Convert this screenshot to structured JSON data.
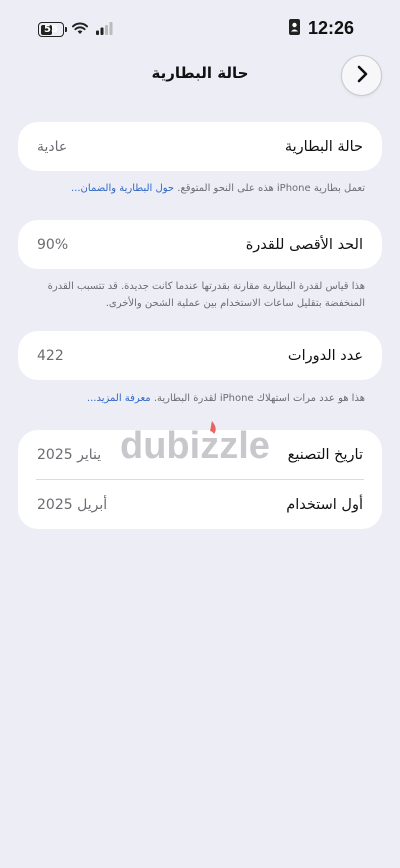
{
  "status_bar": {
    "time": "12:26",
    "battery_level": "55",
    "icons": [
      "battery-icon",
      "wifi-icon",
      "signal-icon",
      "id-card-icon"
    ]
  },
  "nav": {
    "title": "حالة البطارية",
    "back_icon": "chevron-right-icon"
  },
  "battery_health": {
    "label": "حالة البطارية",
    "value": "عادية",
    "footnote": "تعمل بطارية iPhone هذه على النحو المتوقع.",
    "footnote_link": "حول البطارية والضمان..."
  },
  "maximum_capacity": {
    "label": "الحد الأقصى للقدرة",
    "value": "90%",
    "footnote": "هذا قياس لقدرة البطارية مقارنة بقدرتها عندما كانت جديدة. قد تتسبب القدرة المنخفضة بتقليل ساعات الاستخدام بين عملية الشحن والأخرى."
  },
  "cycle_count": {
    "label": "عدد الدورات",
    "value": "422",
    "footnote": "هذا هو عدد مرات استهلاك iPhone لقدرة البطارية.",
    "footnote_link": "معرفة المزيد..."
  },
  "dates": {
    "manufacture_label": "تاريخ التصنيع",
    "manufacture_value": "يناير 2025",
    "first_use_label": "أول استخدام",
    "first_use_value": "أبريل 2025"
  },
  "watermark": {
    "text": "dubizzle",
    "color": "#e0453b"
  }
}
